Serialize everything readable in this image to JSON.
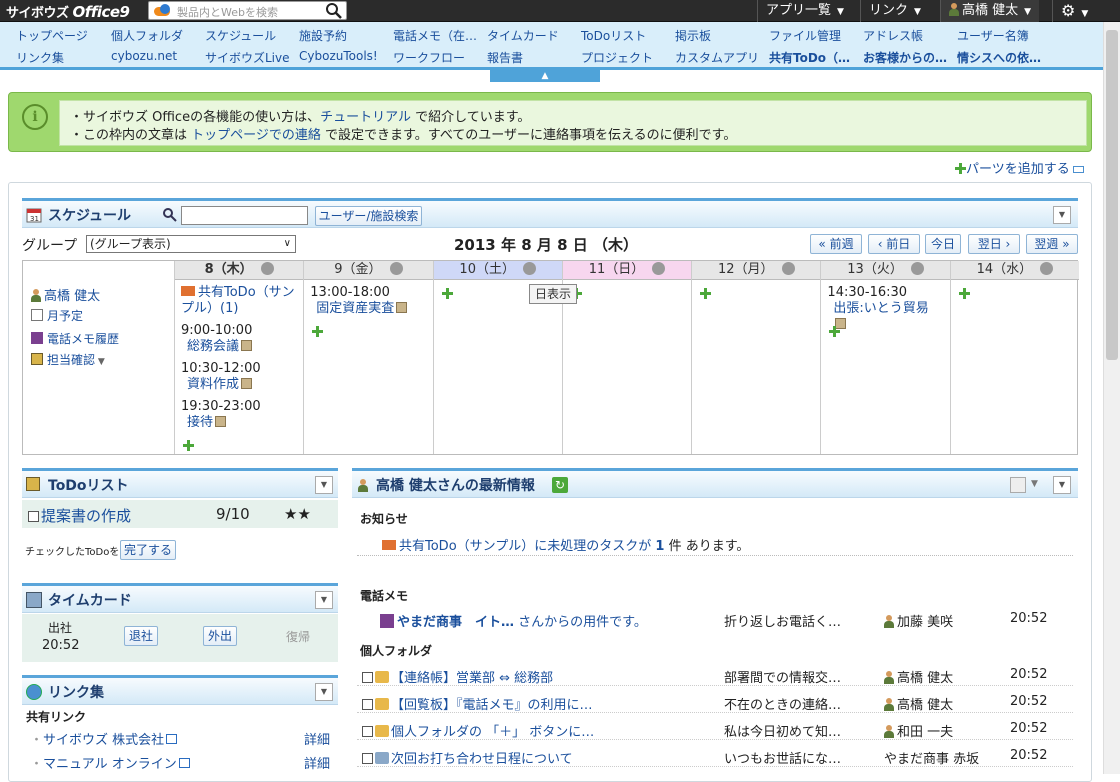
{
  "logo": {
    "prefix": "サイボウズ",
    "main": "Office9"
  },
  "search": {
    "placeholder": "製品内とWebを検索"
  },
  "topbar": {
    "apps": "アプリ一覧",
    "links": "リンク",
    "user": "高橋 健太"
  },
  "nav": {
    "row1": [
      "トップページ",
      "個人フォルダ",
      "スケジュール",
      "施設予約",
      "電話メモ（在…",
      "タイムカード",
      "ToDoリスト",
      "掲示板",
      "ファイル管理",
      "アドレス帳",
      "ユーザー名簿"
    ],
    "row2": [
      "リンク集",
      "cybozu.net",
      "サイボウズLive",
      "CybozuTools!",
      "ワークフロー",
      "報告書",
      "プロジェクト",
      "カスタムアプリ",
      "共有ToDo（…",
      "お客様からの…",
      "情シスへの依…"
    ]
  },
  "info": {
    "line1_a": "・サイボウズ Officeの各機能の使い方は、",
    "line1_link": "チュートリアル",
    "line1_b": " で紹介しています。",
    "line2_a": "・この枠内の文章は ",
    "line2_link": "トップページでの連絡",
    "line2_b": " で設定できます。すべてのユーザーに連絡事項を伝えるのに便利です。"
  },
  "add_parts": "パーツを追加する",
  "schedule": {
    "title": "スケジュール",
    "search_btn": "ユーザー/施設検索",
    "group_label": "グループ",
    "group_select": "(グループ表示)",
    "date": "2013 年 8 月 8 日 （木）",
    "nav_buttons": [
      "« 前週",
      "‹ 前日",
      "今日",
      "翌日 ›",
      "翌週 »"
    ],
    "user": "高橋 健太",
    "side_links": [
      "月予定",
      "電話メモ履歴",
      "担当確認"
    ],
    "days": [
      {
        "label": "8（木）",
        "events": [
          {
            "title": "共有ToDo（サンプル）(1)"
          },
          {
            "time": "9:00-10:00",
            "title": "総務会議"
          },
          {
            "time": "10:30-12:00",
            "title": "資料作成"
          },
          {
            "time": "19:30-23:00",
            "title": "接待"
          }
        ]
      },
      {
        "label": "9（金）",
        "events": [
          {
            "time": "13:00-18:00",
            "title": "固定資産実査"
          }
        ]
      },
      {
        "label": "10（土）",
        "events": []
      },
      {
        "label": "11（日）",
        "events": []
      },
      {
        "label": "12（月）",
        "events": []
      },
      {
        "label": "13（火）",
        "events": [
          {
            "time": "14:30-16:30",
            "title": "出張:いとう貿易"
          }
        ]
      },
      {
        "label": "14（水）",
        "events": []
      }
    ],
    "tooltip": "日表示"
  },
  "todo": {
    "title": "ToDoリスト",
    "item": "提案書の作成",
    "date": "9/10",
    "stars": "★★",
    "checked_label": "チェックしたToDoを",
    "done_btn": "完了する"
  },
  "timecard": {
    "title": "タイムカード",
    "in_label": "出社",
    "in_time": "20:52",
    "out_btn": "退社",
    "away_btn": "外出",
    "return_label": "復帰"
  },
  "links": {
    "title": "リンク集",
    "shared_label": "共有リンク",
    "items": [
      {
        "name": "サイボウズ 株式会社",
        "detail": "詳細"
      },
      {
        "name": "マニュアル オンライン",
        "detail": "詳細"
      }
    ]
  },
  "news": {
    "title": "高橋 健太さんの最新情報",
    "notice_label": "お知らせ",
    "notice_a": "共有ToDo（サンプル）に未処理のタスクが ",
    "notice_count": "1",
    "notice_b": " 件 あります。",
    "memo_label": "電話メモ",
    "memo": {
      "from": "やまだ商事　イト…",
      "text": " さんからの用件です。",
      "content": "折り返しお電話く…",
      "user": "加藤 美咲",
      "time": "20:52"
    },
    "folder_label": "個人フォルダ",
    "folder": [
      {
        "title": "【連絡帳】営業部 ⇔ 総務部",
        "preview": "部署間での情報交…",
        "user": "高橋 健太",
        "time": "20:52"
      },
      {
        "title": "【回覧板】『電話メモ』の利用に…",
        "preview": "不在のときの連絡…",
        "user": "高橋 健太",
        "time": "20:52"
      },
      {
        "title": "個人フォルダの 「＋」 ボタンに…",
        "preview": "私は今日初めて知…",
        "user": "和田 一夫",
        "time": "20:52"
      },
      {
        "title": "次回お打ち合わせ日程について",
        "preview": "いつもお世話にな…",
        "user": "やまだ商事 赤坂",
        "time": "20:52"
      }
    ]
  }
}
